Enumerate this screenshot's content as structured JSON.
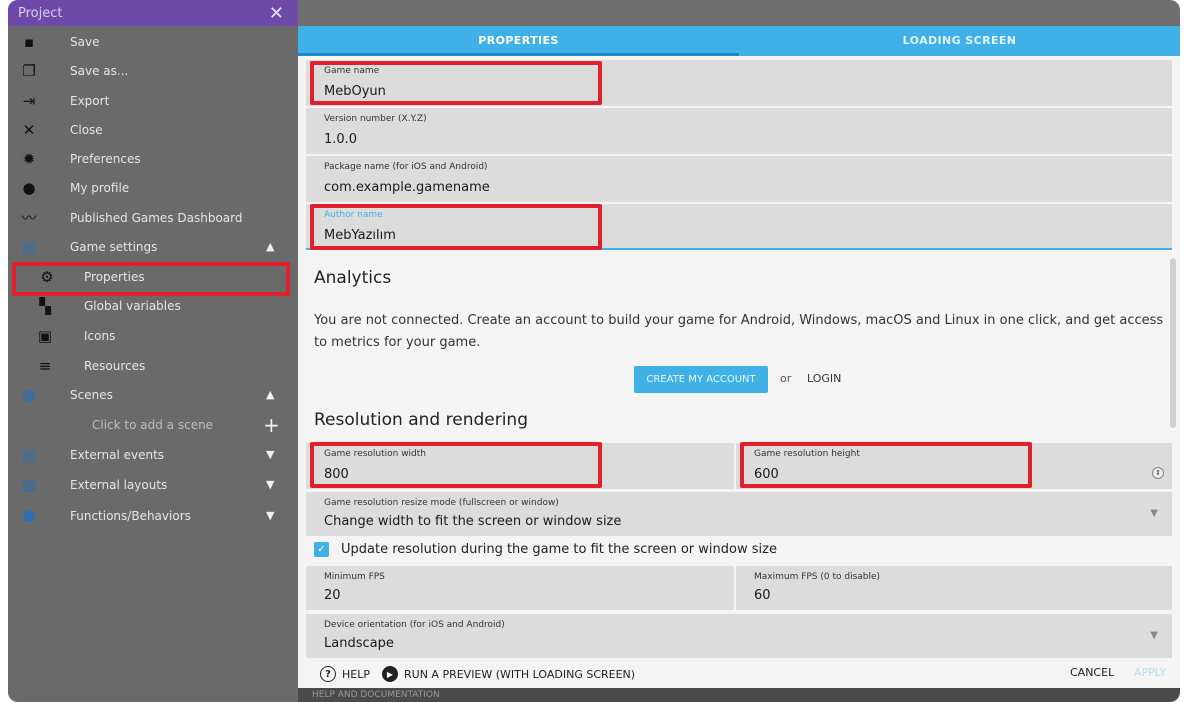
{
  "sidebar": {
    "title": "Project",
    "items": [
      {
        "label": "Save",
        "icon": "floppy-disk-icon"
      },
      {
        "label": "Save as...",
        "icon": "copy-icon"
      },
      {
        "label": "Export",
        "icon": "export-icon"
      },
      {
        "label": "Close",
        "icon": "close-icon"
      },
      {
        "label": "Preferences",
        "icon": "gear-icon"
      },
      {
        "label": "My profile",
        "icon": "user-icon"
      },
      {
        "label": "Published Games Dashboard",
        "icon": "chart-icon"
      },
      {
        "label": "Game settings",
        "icon": "game-settings-icon"
      },
      {
        "label": "Properties",
        "icon": "properties-icon"
      },
      {
        "label": "Global variables",
        "icon": "variables-icon"
      },
      {
        "label": "Icons",
        "icon": "image-icon"
      },
      {
        "label": "Resources",
        "icon": "resources-icon"
      },
      {
        "label": "Scenes",
        "icon": "scenes-icon"
      },
      {
        "label": "Click to add a scene",
        "icon": "plus-icon"
      },
      {
        "label": "External events",
        "icon": "events-icon"
      },
      {
        "label": "External layouts",
        "icon": "layouts-icon"
      },
      {
        "label": "Functions/Behaviors",
        "icon": "extension-icon"
      }
    ]
  },
  "tabs": [
    "PROPERTIES",
    "LOADING SCREEN"
  ],
  "fields": {
    "game_name": {
      "label": "Game name",
      "value": "MebOyun"
    },
    "version": {
      "label": "Version number (X.Y.Z)",
      "value": "1.0.0"
    },
    "package": {
      "label": "Package name (for iOS and Android)",
      "value": "com.example.gamename"
    },
    "author": {
      "label": "Author name",
      "value": "MebYazılım"
    },
    "res_width": {
      "label": "Game resolution width",
      "value": "800"
    },
    "res_height": {
      "label": "Game resolution height",
      "value": "600"
    },
    "resize_mode": {
      "label": "Game resolution resize mode (fullscreen or window)",
      "value": "Change width to fit the screen or window size"
    },
    "min_fps": {
      "label": "Minimum FPS",
      "value": "20"
    },
    "max_fps": {
      "label": "Maximum FPS (0 to disable)",
      "value": "60"
    },
    "orientation": {
      "label": "Device orientation (for iOS and Android)",
      "value": "Landscape"
    }
  },
  "analytics": {
    "title": "Analytics",
    "text": "You are not connected. Create an account to build your game for Android, Windows, macOS and Linux in one click, and get access to metrics for your game.",
    "create_button": "CREATE MY ACCOUNT",
    "or": "or",
    "login": "LOGIN"
  },
  "resolution_title": "Resolution and rendering",
  "update_checkbox": "Update resolution during the game to fit the screen or window size",
  "footer": {
    "help": "HELP",
    "preview": "RUN A PREVIEW (WITH LOADING SCREEN)",
    "cancel": "CANCEL",
    "apply": "APPLY"
  },
  "bottom_strip": "HELP AND DOCUMENTATION",
  "colors": {
    "accent": "#3fb1e6",
    "highlight": "#e0202a",
    "titlebar": "#6d4aa8"
  }
}
